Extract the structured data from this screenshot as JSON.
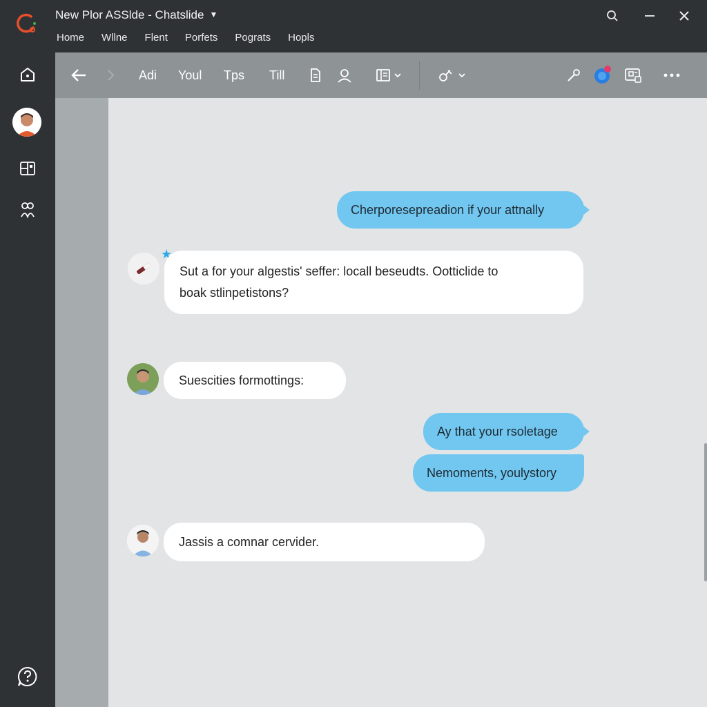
{
  "window": {
    "title": "New Plor ASSlde - Chatslide",
    "menu": [
      "Home",
      "Wllne",
      "Flent",
      "Porfets",
      "Pograts",
      "Hopls"
    ]
  },
  "toolbar": {
    "items": [
      "Adi",
      "Youl",
      "Tps",
      "Till"
    ]
  },
  "messages": [
    {
      "side": "out",
      "text": "Cherporesepreadion if your attnally"
    },
    {
      "side": "in",
      "line1": "Sut a for your algestis' seffer: locall beseudts. Ootticlide to",
      "line2": "boak stlinpetistons?"
    },
    {
      "side": "in",
      "text": "Suescities formottings:"
    },
    {
      "side": "out",
      "text": "Ay that your rsoletage"
    },
    {
      "side": "out",
      "text": "Nemoments, youlystory"
    },
    {
      "side": "in",
      "text": "Jassis a comnar cervider."
    }
  ],
  "colors": {
    "titlebar": "#2f3235",
    "toolbar": "#8e9396",
    "outgoing_bubble": "#72c7f0",
    "incoming_bubble": "#ffffff",
    "accent": "#e8502a"
  }
}
